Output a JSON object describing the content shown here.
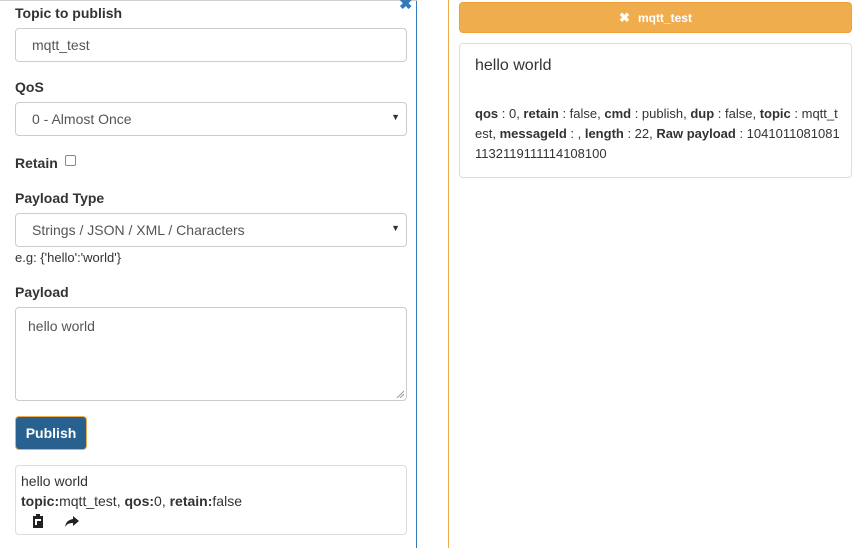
{
  "publisher": {
    "topic_label": "Topic to publish",
    "topic_value": "mqtt_test",
    "qos_label": "QoS",
    "qos_selected": "0 - Almost Once",
    "retain_label": "Retain",
    "retain_checked": false,
    "payload_type_label": "Payload Type",
    "payload_type_selected": "Strings / JSON / XML / Characters",
    "payload_hint": "e.g: {'hello':'world'}",
    "payload_label": "Payload",
    "payload_value": "hello world",
    "publish_button": "Publish"
  },
  "history": {
    "payload": "hello world",
    "topic_key": "topic:",
    "topic_val": "mqtt_test, ",
    "qos_key": "qos:",
    "qos_val": "0, ",
    "retain_key": "retain:",
    "retain_val": "false",
    "icons": [
      "clipboard-icon",
      "share-arrow-icon"
    ]
  },
  "subscription": {
    "topic_header": "mqtt_test",
    "message": {
      "payload": "hello world",
      "qos_key": "qos",
      "qos_val": " : 0, ",
      "retain_key": "retain",
      "retain_val": " : false, ",
      "cmd_key": "cmd",
      "cmd_val": " : publish, ",
      "dup_key": "dup",
      "dup_val": " : false, ",
      "topic_key": "topic",
      "topic_val": " : mqtt_test, ",
      "messageid_key": "messageId",
      "messageid_val": " : , ",
      "length_key": "length",
      "length_val": " : 22, ",
      "raw_key": "Raw payload",
      "raw_val": " : 10410110810811132119111114108100"
    }
  },
  "colors": {
    "primary": "#337ab7",
    "publish_button_bg": "#286090",
    "warning": "#f0ad4e"
  }
}
